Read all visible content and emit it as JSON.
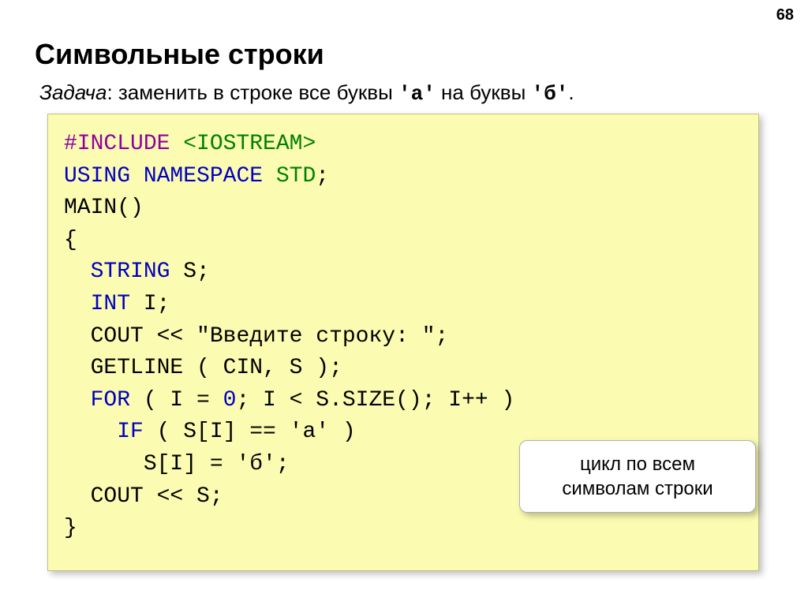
{
  "page_number": "68",
  "title": "Символьные строки",
  "task": {
    "label": "Задача",
    "text_before": ": заменить в строке все буквы ",
    "letter1": "'а'",
    "text_mid": " на буквы ",
    "letter2": "'б'",
    "text_end": "."
  },
  "code": {
    "l1_include": "#include",
    "l1_lib": " <iostream>",
    "l2_using": "using",
    "l2_ns": " namespace",
    "l2_std": " std",
    "l2_semi": ";",
    "l3": "main()",
    "l4": "{",
    "l5_type": "  string",
    "l5_rest": " s;",
    "l6_type": "  int",
    "l6_rest": " i;",
    "l7_ident": "  cout",
    "l7_op": " << ",
    "l7_str": "\"Введите строку: \"",
    "l7_semi": ";",
    "l8_ident": "  getline",
    "l8_rest": " ( cin, s );",
    "l9_for": "  for",
    "l9_a": " ( i = ",
    "l9_zero": "0",
    "l9_b": "; i < s.size(); i++ )",
    "l10_if": "    if",
    "l10_a": " ( s[i] == ",
    "l10_ch": "'а'",
    "l10_b": " )",
    "l11_a": "      s[i] = ",
    "l11_ch": "'б'",
    "l11_b": ";",
    "l12_ident": "  cout",
    "l12_rest": " << s;",
    "l13": "}"
  },
  "callout": {
    "line1": "цикл по всем",
    "line2": "символам строки"
  }
}
